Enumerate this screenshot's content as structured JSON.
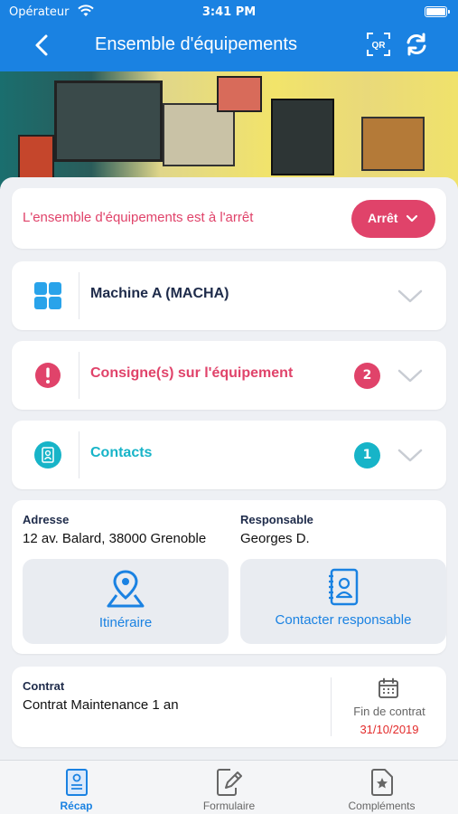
{
  "status_bar": {
    "carrier": "Opérateur",
    "time": "3:41 PM"
  },
  "nav": {
    "title": "Ensemble d'équipements",
    "qr_label": "QR"
  },
  "alert": {
    "message": "L'ensemble d'équipements est à l'arrêt",
    "state_label": "Arrêt"
  },
  "sections": {
    "machine": {
      "label": "Machine A (MACHA)"
    },
    "consigne": {
      "label": "Consigne(s) sur l'équipement",
      "count": "2"
    },
    "contacts": {
      "label": "Contacts",
      "count": "1"
    }
  },
  "address": {
    "address_label": "Adresse",
    "address_value": "12 av. Balard, 38000 Grenoble",
    "manager_label": "Responsable",
    "manager_value": "Georges D.",
    "route_label": "Itinéraire",
    "contact_label": "Contacter responsable"
  },
  "contract": {
    "label": "Contrat",
    "value": "Contrat Maintenance 1 an",
    "end_label": "Fin de contrat",
    "end_value": "31/10/2019"
  },
  "tabs": [
    {
      "label": "Récap",
      "icon": "recap-icon"
    },
    {
      "label": "Formulaire",
      "icon": "form-icon"
    },
    {
      "label": "Compléments",
      "icon": "complements-icon"
    }
  ],
  "colors": {
    "primary": "#1a82e2",
    "alert": "#e0436a",
    "contacts": "#17b4c8",
    "navy": "#1e2b4a",
    "date": "#e32b2b"
  }
}
